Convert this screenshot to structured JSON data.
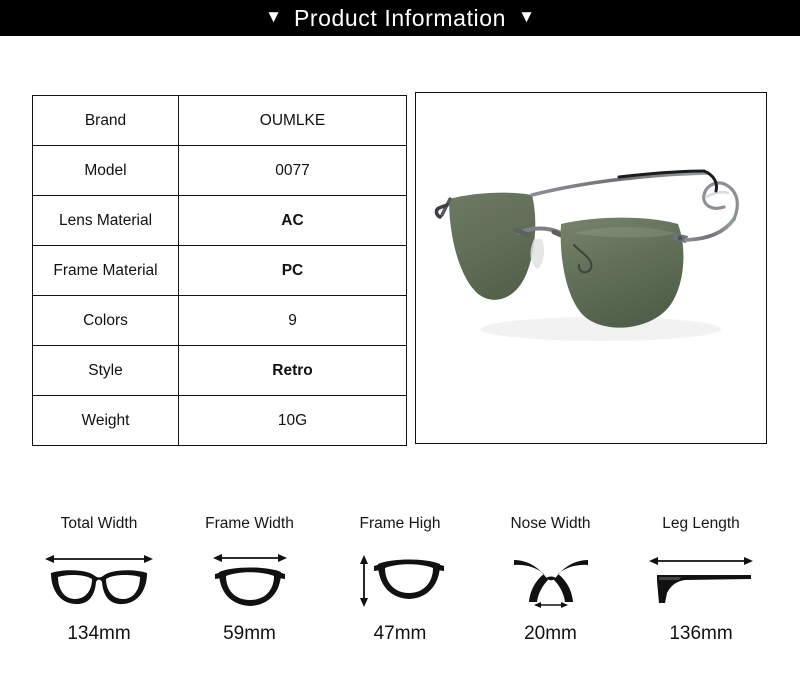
{
  "header": {
    "caret_left": "▼",
    "title": "Product Information",
    "caret_right": "▼"
  },
  "spec_table": {
    "rows": [
      {
        "label": "Brand",
        "value": "OUMLKE",
        "bold": false
      },
      {
        "label": "Model",
        "value": "0077",
        "bold": false
      },
      {
        "label": "Lens Material",
        "value": "AC",
        "bold": true
      },
      {
        "label": "Frame Material",
        "value": "PC",
        "bold": true
      },
      {
        "label": "Colors",
        "value": "9",
        "bold": false
      },
      {
        "label": "Style",
        "value": "Retro",
        "bold": true
      },
      {
        "label": "Weight",
        "value": "10G",
        "bold": false
      }
    ]
  },
  "product_image": {
    "alt": "rimless aviator sunglasses with dark green lenses",
    "lens_color": "#5f6e57",
    "lens_color_light": "#7d8a74",
    "frame_color": "#7a7d80",
    "temple_tip_color": "#1c1c1c"
  },
  "measurements": [
    {
      "label": "Total Width",
      "value": "134mm",
      "icon": "full-frame-icon",
      "arrow": "horizontal-top"
    },
    {
      "label": "Frame Width",
      "value": "59mm",
      "icon": "single-lens-icon",
      "arrow": "horizontal-top"
    },
    {
      "label": "Frame High",
      "value": "47mm",
      "icon": "single-lens-icon",
      "arrow": "vertical-left"
    },
    {
      "label": "Nose Width",
      "value": "20mm",
      "icon": "nose-bridge-icon",
      "arrow": "horizontal-bottom"
    },
    {
      "label": "Leg Length",
      "value": "136mm",
      "icon": "temple-arm-icon",
      "arrow": "horizontal-top"
    }
  ],
  "colors": {
    "header_bg": "#000000",
    "header_text": "#ffffff",
    "border": "#111111",
    "text": "#111111",
    "page_bg": "#ffffff"
  }
}
